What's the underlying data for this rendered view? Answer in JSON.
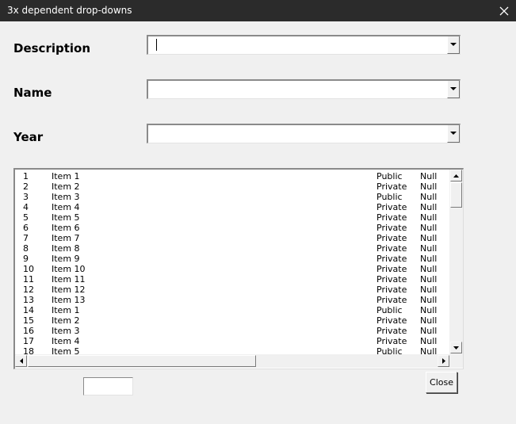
{
  "window": {
    "title": "3x dependent drop-downs",
    "close_glyph": "✕"
  },
  "form": {
    "description_label": "Description",
    "description_value": "",
    "name_label": "Name",
    "name_value": "",
    "year_label": "Year",
    "year_value": ""
  },
  "list": {
    "rows": [
      [
        "1",
        "Item 1",
        "Public",
        "Null"
      ],
      [
        "2",
        "Item 2",
        "Private",
        "Null"
      ],
      [
        "3",
        "Item 3",
        "Public",
        "Null"
      ],
      [
        "4",
        "Item 4",
        "Private",
        "Null"
      ],
      [
        "5",
        "Item 5",
        "Private",
        "Null"
      ],
      [
        "6",
        "Item 6",
        "Private",
        "Null"
      ],
      [
        "7",
        "Item 7",
        "Private",
        "Null"
      ],
      [
        "8",
        "Item 8",
        "Private",
        "Null"
      ],
      [
        "9",
        "Item 9",
        "Private",
        "Null"
      ],
      [
        "10",
        "Item 10",
        "Private",
        "Null"
      ],
      [
        "11",
        "Item 11",
        "Private",
        "Null"
      ],
      [
        "12",
        "Item 12",
        "Private",
        "Null"
      ],
      [
        "13",
        "Item 13",
        "Private",
        "Null"
      ],
      [
        "14",
        "Item 1",
        "Public",
        "Null"
      ],
      [
        "15",
        "Item 2",
        "Private",
        "Null"
      ],
      [
        "16",
        "Item 3",
        "Private",
        "Null"
      ],
      [
        "17",
        "Item 4",
        "Private",
        "Null"
      ],
      [
        "18",
        "Item 5",
        "Public",
        "Null"
      ]
    ]
  },
  "footer": {
    "small_field_value": "",
    "close_label": "Close"
  }
}
